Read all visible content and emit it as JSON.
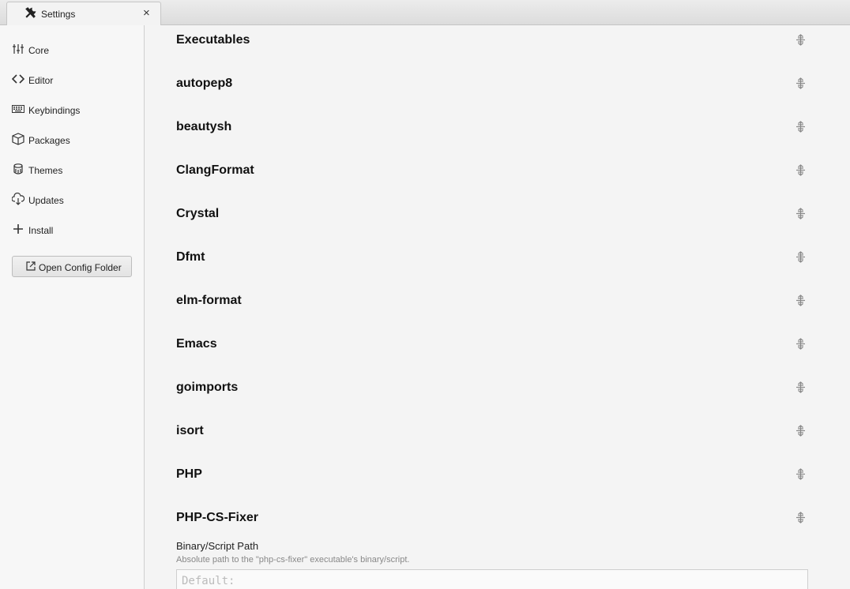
{
  "tab": {
    "title": "Settings",
    "close": "×"
  },
  "sidebar": {
    "items": [
      {
        "label": "Core",
        "icon": "sliders-icon"
      },
      {
        "label": "Editor",
        "icon": "code-icon"
      },
      {
        "label": "Keybindings",
        "icon": "keyboard-icon"
      },
      {
        "label": "Packages",
        "icon": "package-icon"
      },
      {
        "label": "Themes",
        "icon": "paintcan-icon"
      },
      {
        "label": "Updates",
        "icon": "cloud-download-icon"
      },
      {
        "label": "Install",
        "icon": "plus-icon"
      }
    ],
    "open_config_folder": "Open Config Folder"
  },
  "main": {
    "sections": [
      "Executables",
      "autopep8",
      "beautysh",
      "ClangFormat",
      "Crystal",
      "Dfmt",
      "elm-format",
      "Emacs",
      "goimports",
      "isort",
      "PHP",
      "PHP-CS-Fixer"
    ],
    "field": {
      "label": "Binary/Script Path",
      "description": "Absolute path to the \"php-cs-fixer\" executable's binary/script.",
      "placeholder": "Default:"
    }
  }
}
